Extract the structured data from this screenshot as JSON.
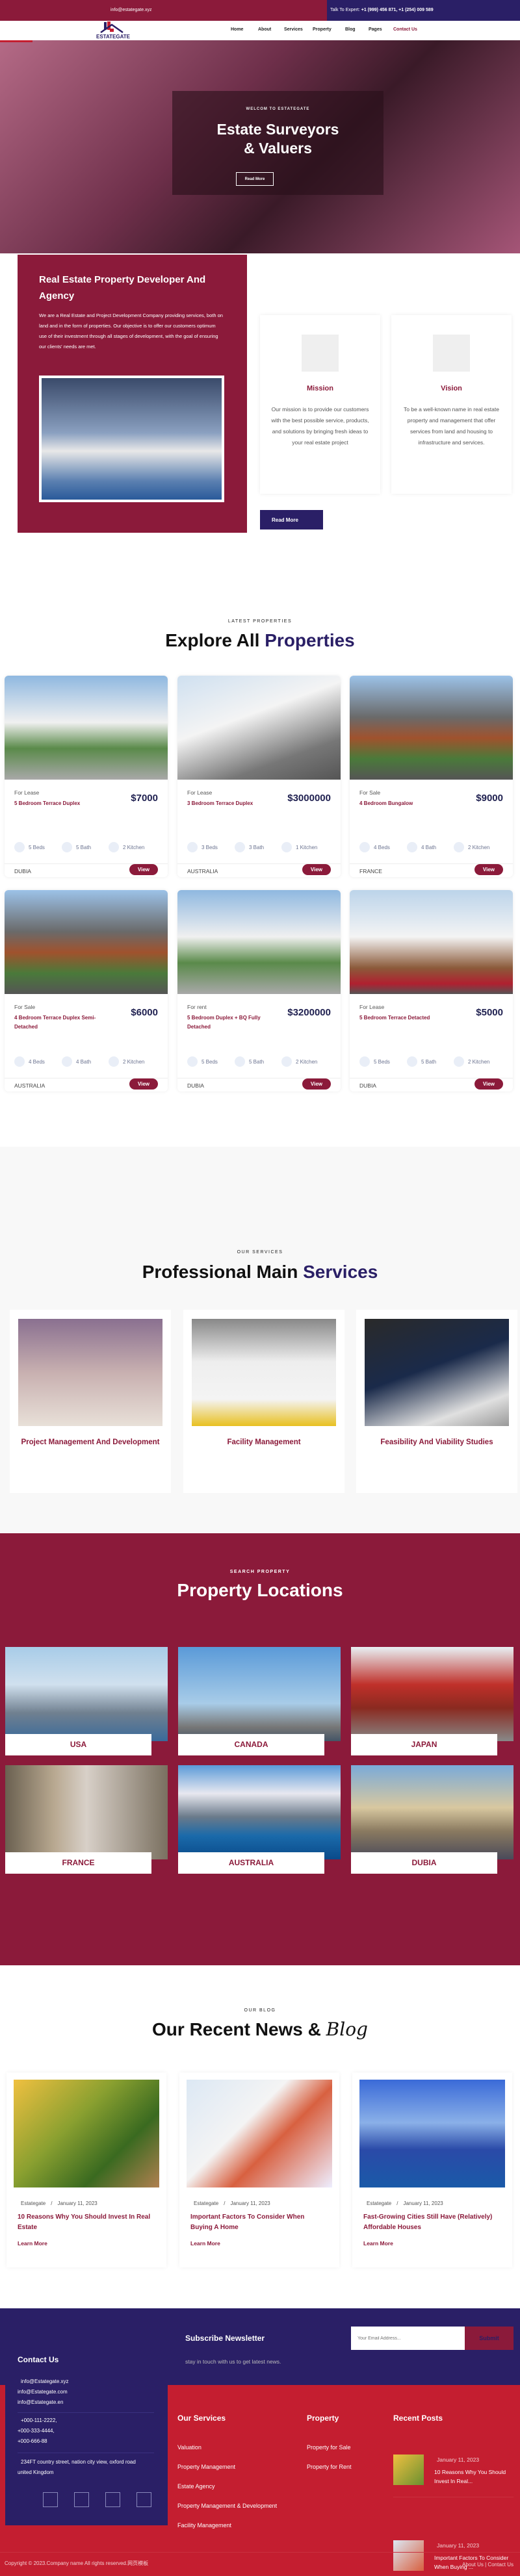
{
  "topbar": {
    "email": "info@estategate.xyz",
    "expert_label": "Talk To Expert:",
    "expert_phones": "+1 (999) 456 871, +1 (254) 009 589"
  },
  "brand": {
    "logo_text": "ESTATEGATE"
  },
  "nav": [
    {
      "label": "Home"
    },
    {
      "label": "About"
    },
    {
      "label": "Services"
    },
    {
      "label": "Property"
    },
    {
      "label": "Blog"
    },
    {
      "label": "Pages"
    },
    {
      "label": "Contact Us",
      "active": true
    }
  ],
  "hero": {
    "eyebrow": "WELCOM TO ESTATEGATE",
    "title_line1": "Estate Surveyors",
    "title_line2": "& Valuers",
    "button": "Read More"
  },
  "about": {
    "title": "Real Estate Property Developer And Agency",
    "text": "We are a Real Estate and Project Development Company providing services, both on land and in the form of properties. Our objective is to offer our customers optimum use of their investment through all stages of development, with the goal of ensuring our clients' needs are met.",
    "read_more": "Read More"
  },
  "mission": {
    "title": "Mission",
    "text": "Our mission is to provide our customers with the best possible service, products, and solutions by bringing fresh ideas to your real estate project"
  },
  "vision": {
    "title": "Vision",
    "text": "To be a well-known name in real estate property and management that offer services from land and housing to infrastructure and services."
  },
  "properties": {
    "eyebrow": "LATEST PROPERTIES",
    "title": "Explore All",
    "title_accent": "Properties",
    "view_label": "View",
    "items": [
      {
        "type": "For Lease",
        "name": "5 Bedroom Terrace Duplex",
        "price": "$7000",
        "beds": "5 Beds",
        "bath": "5 Bath",
        "kitchen": "2 Kitchen",
        "location": "DUBIA"
      },
      {
        "type": "For Lease",
        "name": "3 Bedroom Terrace Duplex",
        "price": "$3000000",
        "beds": "3 Beds",
        "bath": "3 Bath",
        "kitchen": "1 Kitchen",
        "location": "AUSTRALIA"
      },
      {
        "type": "For Sale",
        "name": "4 Bedroom Bungalow",
        "price": "$9000",
        "beds": "4 Beds",
        "bath": "4 Bath",
        "kitchen": "2 Kitchen",
        "location": "FRANCE"
      },
      {
        "type": "For Sale",
        "name": "4 Bedroom Terrace Duplex Semi-Detached",
        "price": "$6000",
        "beds": "4 Beds",
        "bath": "4 Bath",
        "kitchen": "2 Kitchen",
        "location": "AUSTRALIA"
      },
      {
        "type": "For rent",
        "name": "5 Bedroom Duplex + BQ Fully Detached",
        "price": "$3200000",
        "beds": "5 Beds",
        "bath": "5 Bath",
        "kitchen": "2 Kitchen",
        "location": "DUBIA"
      },
      {
        "type": "For Lease",
        "name": "5 Bedroom Terrace Detacted",
        "price": "$5000",
        "beds": "5 Beds",
        "bath": "5 Bath",
        "kitchen": "2 Kitchen",
        "location": "DUBIA"
      }
    ]
  },
  "services": {
    "eyebrow": "OUR SERVICES",
    "title": "Professional Main",
    "title_accent": "Services",
    "items": [
      {
        "title": "Project Management And Development"
      },
      {
        "title": "Facility Management"
      },
      {
        "title": "Feasibility And Viability Studies"
      }
    ]
  },
  "locations": {
    "eyebrow": "SEARCH PROPERTY",
    "title": "Property Locations",
    "items": [
      {
        "name": "USA"
      },
      {
        "name": "CANADA"
      },
      {
        "name": "JAPAN"
      },
      {
        "name": "FRANCE"
      },
      {
        "name": "AUSTRALIA"
      },
      {
        "name": "DUBIA"
      }
    ]
  },
  "blog": {
    "eyebrow": "OUR BLOG",
    "title": "Our Recent News &",
    "title_accent": "Blog",
    "learn_more": "Learn More",
    "items": [
      {
        "author": "Estategate",
        "date": "January 11, 2023",
        "title": "10 Reasons Why You Should Invest In Real Estate"
      },
      {
        "author": "Estategate",
        "date": "January 11, 2023",
        "title": "Important Factors To Consider When Buying A Home"
      },
      {
        "author": "Estategate",
        "date": "January 11, 2023",
        "title": "Fast-Growing Cities Still Have (Relatively) Affordable Houses"
      }
    ]
  },
  "footer": {
    "newsletter": {
      "title": "Subscribe Newsletter",
      "subtitle": "stay in touch with us to get latest news.",
      "placeholder": "Your Email Address...",
      "submit": "Submit"
    },
    "contact": {
      "title": "Contact Us",
      "emails": [
        "info@Estategate.xyz",
        "info@Estategate.com",
        "info@Estategate.en"
      ],
      "phones": [
        "+000-111-2222,",
        "+000-333-4444,",
        "+000-666-88"
      ],
      "address": "234FT country street, nation city view, oxford road united Kingdom"
    },
    "services": {
      "title": "Our Services",
      "items": [
        "Valuation",
        "Property Management",
        "Estate Agency",
        "Property Management & Development",
        "Facility Management"
      ]
    },
    "property": {
      "title": "Property",
      "items": [
        "Property for Sale",
        "Property for Rent"
      ]
    },
    "recent": {
      "title": "Recent Posts",
      "items": [
        {
          "date": "January 11, 2023",
          "title": "10 Reasons Why You Should Invest In Real..."
        },
        {
          "date": "January 11, 2023",
          "title": "Important Factors To Consider When Buying ..."
        }
      ]
    },
    "copyright": "Copyright © 2023.Company name All rights reserved.网页模板",
    "links": [
      "About Us",
      "Contact Us"
    ],
    "colors": {
      "navy": "#2a1f66",
      "crimson": "#8b1a3a",
      "red": "#c41e30"
    }
  }
}
